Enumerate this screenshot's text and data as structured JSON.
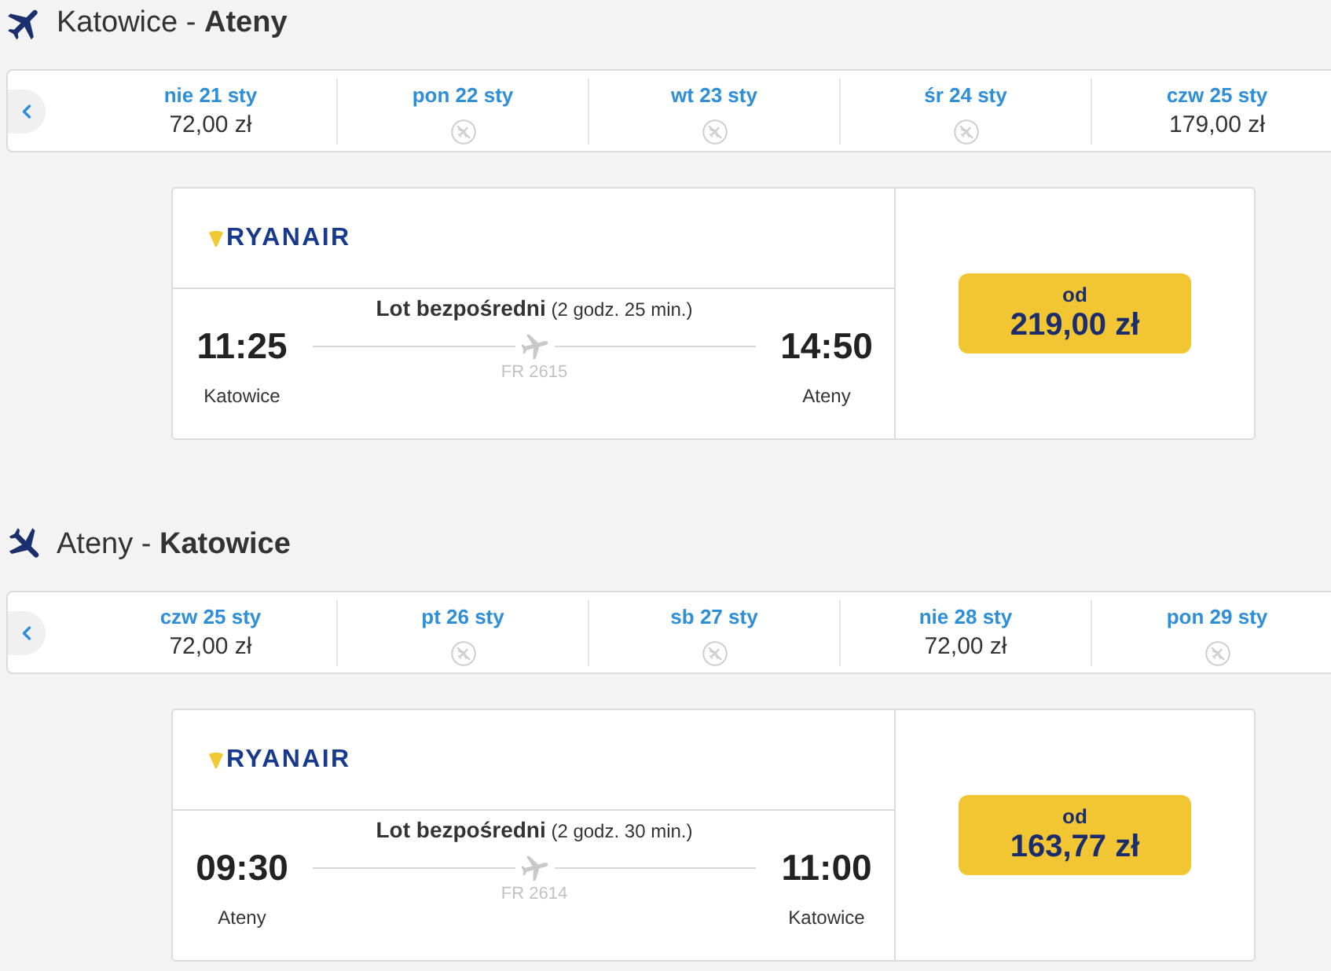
{
  "routes": [
    {
      "kind": "outbound",
      "title": "Katowice - **Ateny**",
      "dates": [
        {
          "label": "nie 21 sty",
          "available": true,
          "price": "72,00 zł"
        },
        {
          "label": "pon 22 sty",
          "available": false
        },
        {
          "label": "wt 23 sty",
          "available": false
        },
        {
          "label": "śr 24 sty",
          "available": false
        },
        {
          "label": "czw 25 sty",
          "available": true,
          "price": "179,00 zł"
        }
      ],
      "flight": {
        "airline": "RYANAIR",
        "summary": "**Lot bezpośredni** (2 godz. 25 min.)",
        "departure": {
          "time": "11:25",
          "city": "Katowice"
        },
        "arrival": {
          "time": "14:50",
          "city": "Ateny"
        },
        "flight_number": "FR 2615",
        "price_label": "od",
        "price": "219,00 zł"
      }
    },
    {
      "kind": "return",
      "title": "Ateny - **Katowice**",
      "dates": [
        {
          "label": "czw 25 sty",
          "available": true,
          "price": "72,00 zł"
        },
        {
          "label": "pt 26 sty",
          "available": false
        },
        {
          "label": "sb 27 sty",
          "available": false
        },
        {
          "label": "nie 28 sty",
          "available": true,
          "price": "72,00 zł"
        },
        {
          "label": "pon 29 sty",
          "available": false
        }
      ],
      "flight": {
        "airline": "RYANAIR",
        "summary": "**Lot bezpośredni** (2 godz. 30 min.)",
        "departure": {
          "time": "09:30",
          "city": "Ateny"
        },
        "arrival": {
          "time": "11:00",
          "city": "Katowice"
        },
        "flight_number": "FR 2614",
        "price_label": "od",
        "price": "163,77 zł"
      }
    }
  ]
}
